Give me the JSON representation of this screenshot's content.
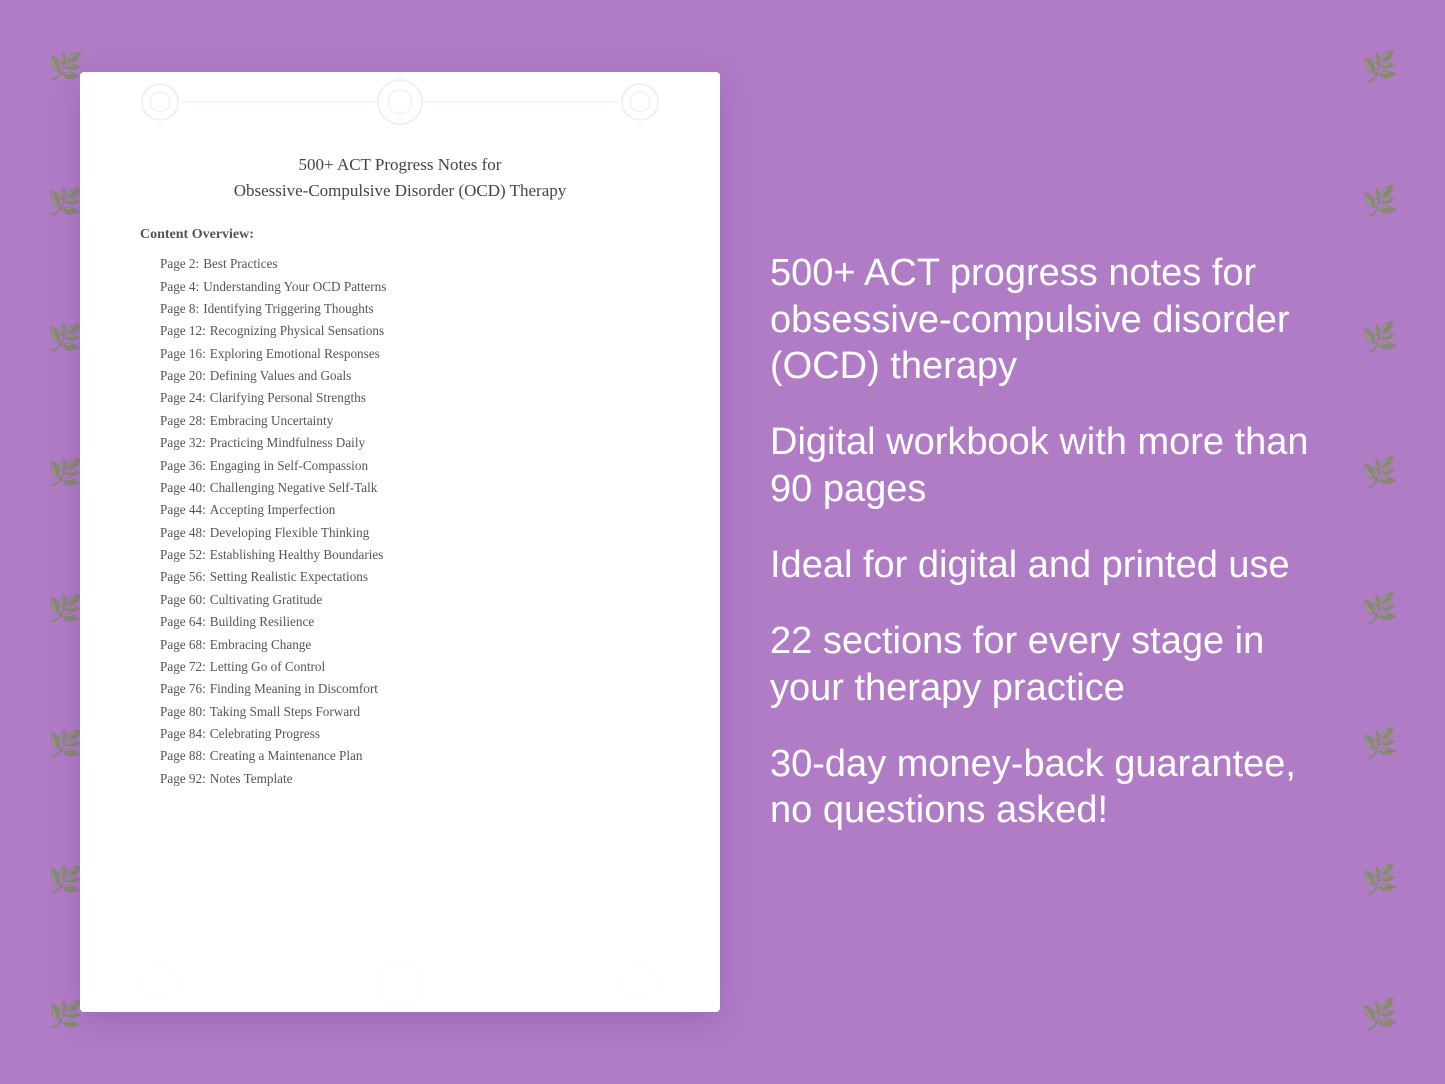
{
  "background": {
    "color": "#b87fd4"
  },
  "book": {
    "title_line1": "500+ ACT Progress Notes for",
    "title_line2": "Obsessive-Compulsive Disorder (OCD) Therapy",
    "content_overview_label": "Content Overview:",
    "toc": [
      {
        "page": "Page  2:",
        "title": "Best Practices"
      },
      {
        "page": "Page  4:",
        "title": "Understanding Your OCD Patterns"
      },
      {
        "page": "Page  8:",
        "title": "Identifying Triggering Thoughts"
      },
      {
        "page": "Page 12:",
        "title": "Recognizing Physical Sensations"
      },
      {
        "page": "Page 16:",
        "title": "Exploring Emotional Responses"
      },
      {
        "page": "Page 20:",
        "title": "Defining Values and Goals"
      },
      {
        "page": "Page 24:",
        "title": "Clarifying Personal Strengths"
      },
      {
        "page": "Page 28:",
        "title": "Embracing Uncertainty"
      },
      {
        "page": "Page 32:",
        "title": "Practicing Mindfulness Daily"
      },
      {
        "page": "Page 36:",
        "title": "Engaging in Self-Compassion"
      },
      {
        "page": "Page 40:",
        "title": "Challenging Negative Self-Talk"
      },
      {
        "page": "Page 44:",
        "title": "Accepting Imperfection"
      },
      {
        "page": "Page 48:",
        "title": "Developing Flexible Thinking"
      },
      {
        "page": "Page 52:",
        "title": "Establishing Healthy Boundaries"
      },
      {
        "page": "Page 56:",
        "title": "Setting Realistic Expectations"
      },
      {
        "page": "Page 60:",
        "title": "Cultivating Gratitude"
      },
      {
        "page": "Page 64:",
        "title": "Building Resilience"
      },
      {
        "page": "Page 68:",
        "title": "Embracing Change"
      },
      {
        "page": "Page 72:",
        "title": "Letting Go of Control"
      },
      {
        "page": "Page 76:",
        "title": "Finding Meaning in Discomfort"
      },
      {
        "page": "Page 80:",
        "title": "Taking Small Steps Forward"
      },
      {
        "page": "Page 84:",
        "title": "Celebrating Progress"
      },
      {
        "page": "Page 88:",
        "title": "Creating a Maintenance Plan"
      },
      {
        "page": "Page 92:",
        "title": "Notes Template"
      }
    ]
  },
  "features": [
    {
      "text": "500+ ACT progress notes for obsessive-compulsive disorder (OCD) therapy"
    },
    {
      "text": "Digital workbook with more than 90 pages"
    },
    {
      "text": "Ideal for digital and printed use"
    },
    {
      "text": "22 sections for every stage in your therapy practice"
    },
    {
      "text": "30-day money-back guarantee, no questions asked!"
    }
  ]
}
